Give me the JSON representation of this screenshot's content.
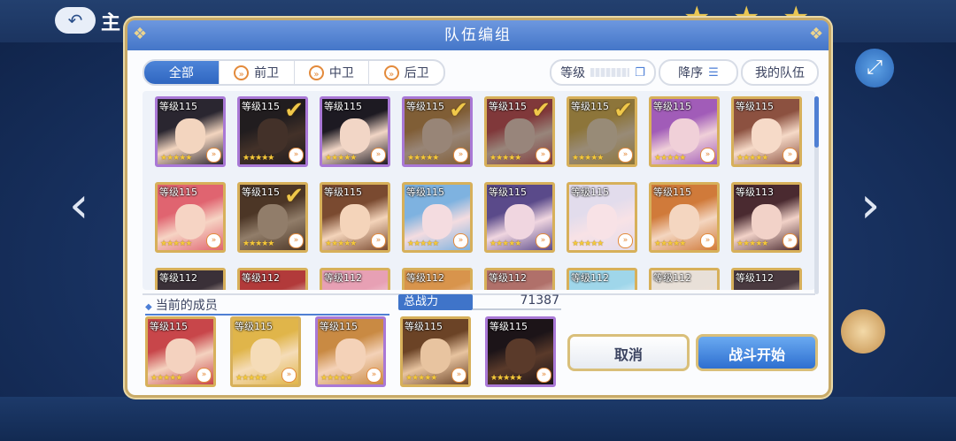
{
  "background": {
    "back_icon": "↶",
    "screen_title": "主",
    "prev_arrow": "‹",
    "next_arrow": "›",
    "fab_icon": "⤢"
  },
  "dialog": {
    "title": "队伍编组",
    "tabs": [
      {
        "label": "全部",
        "icon": ""
      },
      {
        "label": "前卫",
        "icon": "»"
      },
      {
        "label": "中卫",
        "icon": "»"
      },
      {
        "label": "后卫",
        "icon": "»"
      }
    ],
    "sort_level": "等级",
    "sort_order": "降序",
    "my_team": "我的队伍",
    "current_members_label": "当前的成员",
    "power_label": "总战力",
    "power_value": "71387",
    "cancel_label": "取消",
    "start_label": "战斗开始"
  },
  "roster": [
    {
      "level": "等级115",
      "stars": "★★★★★",
      "selected": false,
      "frame": "purple",
      "skin": "#f3d5bf",
      "hair": "#2a2630"
    },
    {
      "level": "等级115",
      "stars": "★★★★★",
      "selected": true,
      "frame": "purple",
      "skin": "#5a3a2a",
      "hair": "#1c1418"
    },
    {
      "level": "等级115",
      "stars": "★★★★★",
      "selected": false,
      "frame": "purple",
      "skin": "#f2d6c6",
      "hair": "#1d1a22"
    },
    {
      "level": "等级115",
      "stars": "★★★★★",
      "selected": true,
      "frame": "purple",
      "skin": "#f4d2b8",
      "hair": "#c98a43"
    },
    {
      "level": "等级115",
      "stars": "★★★★★",
      "selected": true,
      "frame": "gold",
      "skin": "#f4d2bf",
      "hair": "#c8464a"
    },
    {
      "level": "等级115",
      "stars": "★★★★★",
      "selected": true,
      "frame": "gold",
      "skin": "#f5dcb8",
      "hair": "#e0b54a"
    },
    {
      "level": "等级115",
      "stars": "★★★★★",
      "selected": false,
      "frame": "gold",
      "skin": "#f0d0d8",
      "hair": "#a15cb8"
    },
    {
      "level": "等级115",
      "stars": "★★★★★",
      "selected": false,
      "frame": "gold",
      "skin": "#f6dac8",
      "hair": "#8c5140"
    },
    {
      "level": "等级115",
      "stars": "★★★★★",
      "selected": false,
      "frame": "gold",
      "skin": "#f6d4c4",
      "hair": "#e06470"
    },
    {
      "level": "等级115",
      "stars": "★★★★★",
      "selected": true,
      "frame": "gold",
      "skin": "#e8c4a0",
      "hair": "#6b4326"
    },
    {
      "level": "等级115",
      "stars": "★★★★★",
      "selected": false,
      "frame": "gold",
      "skin": "#f4d4ba",
      "hair": "#7a4a30"
    },
    {
      "level": "等级115",
      "stars": "★★★★★",
      "selected": false,
      "frame": "gold",
      "skin": "#f4dce0",
      "hair": "#7eb2e0"
    },
    {
      "level": "等级115",
      "stars": "★★★★★",
      "selected": false,
      "frame": "gold",
      "skin": "#f0d6e0",
      "hair": "#5a4a8a"
    },
    {
      "level": "等级115",
      "stars": "★★★★★",
      "selected": false,
      "frame": "gold",
      "skin": "#f8e2e6",
      "hair": "#e2dcec"
    },
    {
      "level": "等级115",
      "stars": "★★★★★",
      "selected": false,
      "frame": "gold",
      "skin": "#f4d6c0",
      "hair": "#d07a3a"
    },
    {
      "level": "等级113",
      "stars": "★★★★★",
      "selected": false,
      "frame": "gold",
      "skin": "#f2d2c8",
      "hair": "#4a2a30"
    },
    {
      "level": "等级112",
      "stars": "",
      "selected": false,
      "frame": "gold",
      "skin": "#e8d4c8",
      "hair": "#3a3038"
    },
    {
      "level": "等级112",
      "stars": "",
      "selected": false,
      "frame": "gold",
      "skin": "#e8d4c8",
      "hair": "#b23a3a"
    },
    {
      "level": "等级112",
      "stars": "",
      "selected": false,
      "frame": "gold",
      "skin": "#f4d6dc",
      "hair": "#e7a0b4"
    },
    {
      "level": "等级112",
      "stars": "",
      "selected": false,
      "frame": "gold",
      "skin": "#f4d6c4",
      "hair": "#d8944c"
    },
    {
      "level": "等级112",
      "stars": "",
      "selected": false,
      "frame": "gold",
      "skin": "#f0d4cc",
      "hair": "#b0706a"
    },
    {
      "level": "等级112",
      "stars": "",
      "selected": false,
      "frame": "gold",
      "skin": "#eaf2f8",
      "hair": "#9fd6ea"
    },
    {
      "level": "等级112",
      "stars": "",
      "selected": false,
      "frame": "gold",
      "skin": "#f0e0d4",
      "hair": "#e8e0d8"
    },
    {
      "level": "等级112",
      "stars": "",
      "selected": false,
      "frame": "gold",
      "skin": "#e8d4cc",
      "hair": "#4a3a40"
    }
  ],
  "members": [
    {
      "level": "等级115",
      "stars": "★★★★★",
      "frame": "gold",
      "skin": "#f4d2bf",
      "hair": "#c8464a"
    },
    {
      "level": "等级115",
      "stars": "★★★★★",
      "frame": "gold",
      "skin": "#f5dcb8",
      "hair": "#e0b54a"
    },
    {
      "level": "等级115",
      "stars": "★★★★★",
      "frame": "purple",
      "skin": "#f4d2b8",
      "hair": "#c98a43"
    },
    {
      "level": "等级115",
      "stars": "★★★★★",
      "frame": "gold",
      "skin": "#e8c4a0",
      "hair": "#6b4326"
    },
    {
      "level": "等级115",
      "stars": "★★★★★",
      "frame": "purple",
      "skin": "#5a3a2a",
      "hair": "#1c1418"
    }
  ],
  "icons": {
    "role": "»",
    "check": "✔",
    "view_toggle": "❐",
    "sort_lines": "☰",
    "member_dot": "◆"
  }
}
